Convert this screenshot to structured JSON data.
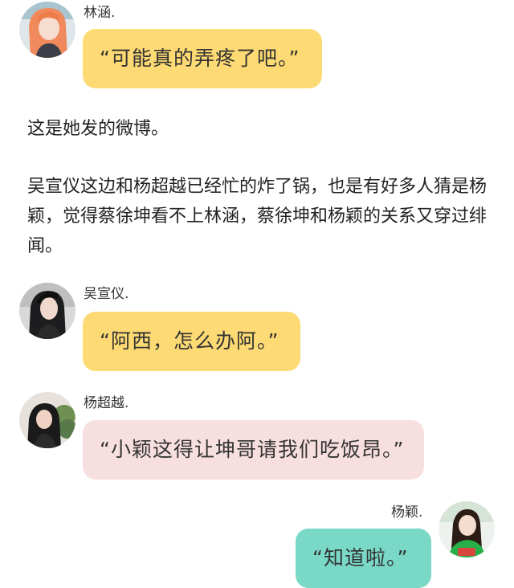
{
  "colors": {
    "yellow_bubble": "#FDDA73",
    "pink_bubble": "#F8DFDF",
    "teal_bubble": "#79D9C6"
  },
  "messages": [
    {
      "sender": "林涵.",
      "text": "“可能真的弄疼了吧。”",
      "avatar_icon": "avatar-orange-hair-girl"
    },
    {
      "sender": "吴宣仪.",
      "text": "“阿西，怎么办阿。”",
      "avatar_icon": "avatar-dark-hair-girl"
    },
    {
      "sender": "杨超越.",
      "text": "“小颖这得让坤哥请我们吃饭昂。”",
      "avatar_icon": "avatar-girl-with-plant"
    },
    {
      "sender": "杨颖.",
      "text": "“知道啦。”",
      "avatar_icon": "avatar-girl-green-shirt"
    }
  ],
  "narration": {
    "p1": "这是她发的微博。",
    "p2": "吴宣仪这边和杨超越已经忙的炸了锅，也是有好多人猜是杨颖，觉得蔡徐坤看不上林涵，蔡徐坤和杨颖的关系又穿过绯闻。"
  }
}
